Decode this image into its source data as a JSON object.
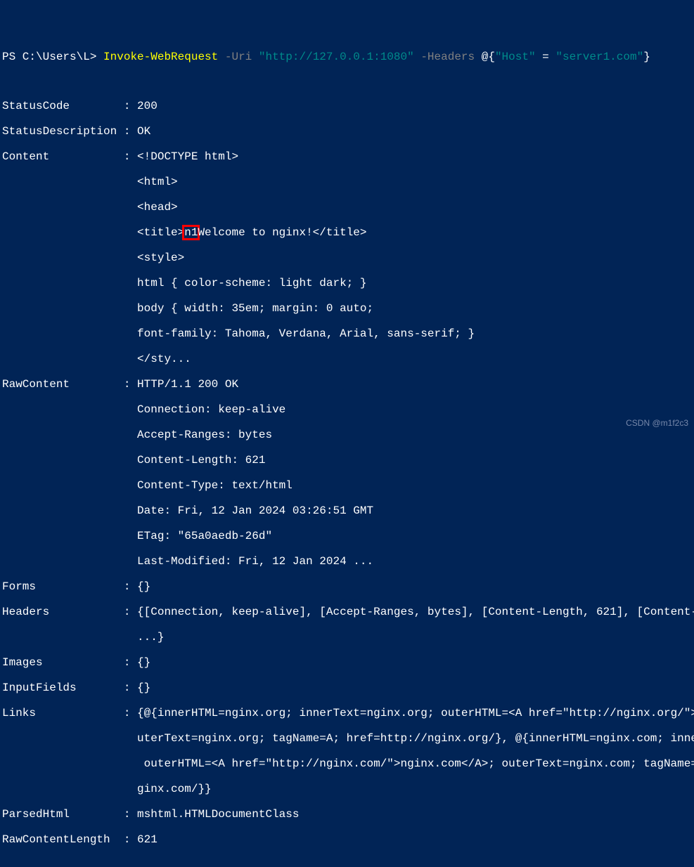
{
  "prompt": {
    "path": "PS C:\\Users\\L> ",
    "command": "Invoke-WebRequest ",
    "param1": "-Uri ",
    "value1": "\"http://127.0.0.1:1080\" ",
    "param2": "-Headers ",
    "value2_prefix": "@{",
    "value2_key": "\"Host\"",
    "value2_eq": " = ",
    "value2_val": "\"server1.com\"",
    "value2_suffix": "}"
  },
  "output": {
    "statusCode_label": "StatusCode       ",
    "statusCode_value": " 200",
    "statusDescription_label": "StatusDescription",
    "statusDescription_value": " OK",
    "content_label": "Content          ",
    "content_line1": " <!DOCTYPE html>",
    "content_line2": "                    <html>",
    "content_line3": "                    <head>",
    "content_line4a": "                    <title>",
    "content_line4_hl": "n1",
    "content_line4b": "Welcome to nginx!</title>",
    "content_line5": "                    <style>",
    "content_line6": "                    html { color-scheme: light dark; }",
    "content_line7": "                    body { width: 35em; margin: 0 auto;",
    "content_line8": "                    font-family: Tahoma, Verdana, Arial, sans-serif; }",
    "content_line9": "                    </sty...",
    "rawContent_label": "RawContent       ",
    "rawContent_line1": " HTTP/1.1 200 OK",
    "rawContent_line2": "                    Connection: keep-alive",
    "rawContent_line3": "                    Accept-Ranges: bytes",
    "rawContent_line4": "                    Content-Length: 621",
    "rawContent_line5": "                    Content-Type: text/html",
    "rawContent_line6": "                    Date: Fri, 12 Jan 2024 03:26:51 GMT",
    "rawContent_line7": "                    ETag: \"65a0aedb-26d\"",
    "rawContent_line8": "                    Last-Modified: Fri, 12 Jan 2024 ...",
    "forms_label": "Forms            ",
    "forms_value": " {}",
    "headers_label": "Headers          ",
    "headers_line1": " {[Connection, keep-alive], [Accept-Ranges, bytes], [Content-Length, 621], [Content-Type, t",
    "headers_line2": "                    ...}",
    "images_label": "Images           ",
    "images_value": " {}",
    "inputFields_label": "InputFields      ",
    "inputFields_value": " {}",
    "links_label": "Links            ",
    "links_line1": " {@{innerHTML=nginx.org; innerText=nginx.org; outerHTML=<A href=\"http://nginx.org/\">nginx.o",
    "links_line2": "                    uterText=nginx.org; tagName=A; href=http://nginx.org/}, @{innerHTML=nginx.com; innerText=n",
    "links_line3": "                     outerHTML=<A href=\"http://nginx.com/\">nginx.com</A>; outerText=nginx.com; tagName=A; href",
    "links_line4": "                    ginx.com/}}",
    "parsedHtml_label": "ParsedHtml       ",
    "parsedHtml_value": " mshtml.HTMLDocumentClass",
    "rawContentLength_label": "RawContentLength ",
    "rawContentLength_value": " 621"
  },
  "sep": " :",
  "watermark": "CSDN @m1f2c3"
}
